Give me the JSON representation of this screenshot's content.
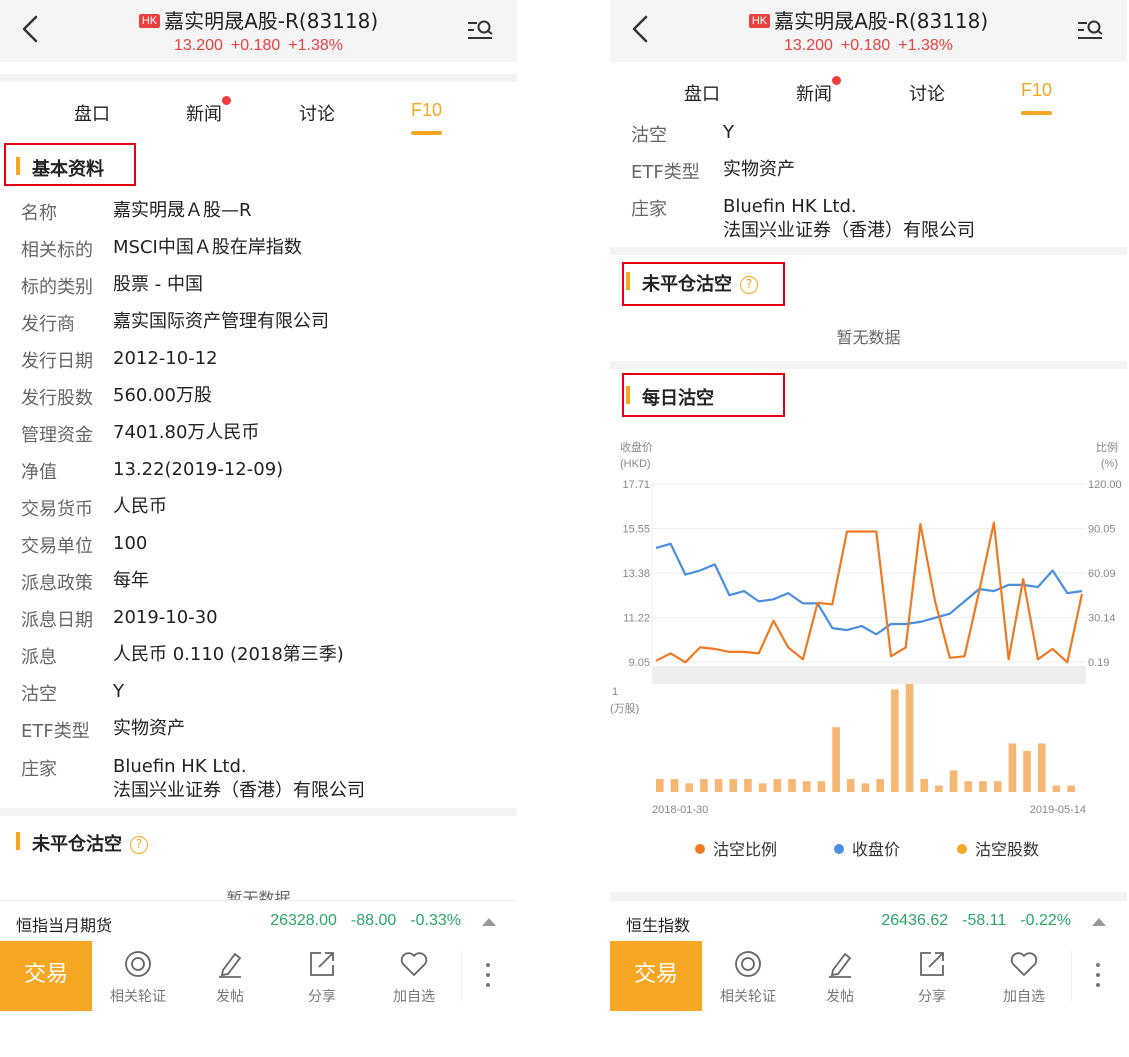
{
  "header": {
    "badge": "HK",
    "title": "嘉实明晟A股-R(83118)",
    "price": "13.200",
    "change": "+0.180",
    "change_pct": "+1.38%"
  },
  "tabs": [
    {
      "label": "盘口"
    },
    {
      "label": "新闻"
    },
    {
      "label": "讨论"
    },
    {
      "label": "F10"
    }
  ],
  "basic": {
    "title": "基本资料",
    "rows": [
      {
        "k": "名称",
        "v": "嘉实明晟Ａ股—R"
      },
      {
        "k": "相关标的",
        "v": "MSCI中国Ａ股在岸指数"
      },
      {
        "k": "标的类别",
        "v": "股票 - 中国"
      },
      {
        "k": "发行商",
        "v": "嘉实国际资产管理有限公司"
      },
      {
        "k": "发行日期",
        "v": "2012-10-12"
      },
      {
        "k": "发行股数",
        "v": "560.00万股"
      },
      {
        "k": "管理资金",
        "v": "7401.80万人民币"
      },
      {
        "k": "净值",
        "v": "13.22(2019-12-09)"
      },
      {
        "k": "交易货币",
        "v": "人民币"
      },
      {
        "k": "交易单位",
        "v": "100"
      },
      {
        "k": "派息政策",
        "v": "每年"
      },
      {
        "k": "派息日期",
        "v": "2019-10-30"
      },
      {
        "k": "派息",
        "v": "人民币 0.110 (2018第三季)"
      },
      {
        "k": "沽空",
        "v": "Y"
      },
      {
        "k": "ETF类型",
        "v": "实物资产"
      },
      {
        "k": "庄家",
        "v": "Bluefin HK Ltd.",
        "v2": "法国兴业证券（香港）有限公司"
      }
    ]
  },
  "open_short": {
    "title": "未平仓沽空",
    "help": "?",
    "empty": "暂无数据"
  },
  "daily_short": {
    "title": "每日沽空"
  },
  "left_ticker": {
    "name": "恒指当月期货",
    "price": "26328.00",
    "change": "-88.00",
    "pct": "-0.33%"
  },
  "right_ticker": {
    "name": "恒生指数",
    "price": "26436.62",
    "change": "-58.11",
    "pct": "-0.22%"
  },
  "bottom": {
    "trade": "交易",
    "items": [
      {
        "label": "相关轮证",
        "icon": "warrant-icon"
      },
      {
        "label": "发帖",
        "icon": "pen-icon"
      },
      {
        "label": "分享",
        "icon": "share-icon"
      },
      {
        "label": "加自选",
        "icon": "heart-icon"
      }
    ]
  },
  "colors": {
    "accent": "#f5a623",
    "up": "#e8413f",
    "down": "#2aa56b",
    "short_ratio_line": "#f07a21",
    "close_line": "#4a8fe0",
    "short_volume_bar": "#f7b774",
    "highlight_box": "#e60012"
  },
  "chart_data": {
    "type": "line",
    "left_axis_label": [
      "收盘价",
      "(HKD)"
    ],
    "right_axis_label": [
      "比例",
      "(%)"
    ],
    "left_ticks": [
      "17.71",
      "15.55",
      "13.38",
      "11.22",
      "9.05"
    ],
    "right_ticks": [
      "120.00",
      "90.05",
      "60.09",
      "30.14",
      "0.19"
    ],
    "ylim_left": [
      9.05,
      17.71
    ],
    "ylim_right": [
      0.19,
      120.0
    ],
    "x_start_label": "2018-01-30",
    "x_end_label": "2019-05-14",
    "series": [
      {
        "name": "沽空比例",
        "axis": "right",
        "values": [
          1,
          6,
          0,
          10,
          9,
          7,
          7,
          6,
          28,
          10,
          2,
          40,
          39,
          88,
          88,
          88,
          4,
          10,
          93,
          41,
          3,
          4,
          48,
          94,
          2,
          56,
          2,
          9,
          0,
          46
        ]
      },
      {
        "name": "收盘价",
        "axis": "left",
        "values": [
          14.6,
          14.8,
          13.3,
          13.5,
          13.8,
          12.3,
          12.5,
          12.0,
          12.1,
          12.4,
          11.9,
          11.9,
          10.7,
          10.6,
          10.8,
          10.4,
          10.9,
          10.9,
          11.0,
          11.2,
          11.4,
          12.0,
          12.6,
          12.5,
          12.8,
          12.8,
          12.7,
          13.5,
          12.4,
          12.5
        ]
      },
      {
        "name": "沽空股数",
        "unit_label": [
          "1",
          "(万股)"
        ],
        "values": [
          0.12,
          0.12,
          0.08,
          0.12,
          0.12,
          0.12,
          0.12,
          0.08,
          0.12,
          0.12,
          0.1,
          0.1,
          0.6,
          0.12,
          0.08,
          0.12,
          0.95,
          1.0,
          0.12,
          0.06,
          0.2,
          0.1,
          0.1,
          0.1,
          0.45,
          0.38,
          0.45,
          0.06,
          0.06
        ]
      }
    ],
    "legend": [
      "沽空比例",
      "收盘价",
      "沽空股数"
    ]
  }
}
